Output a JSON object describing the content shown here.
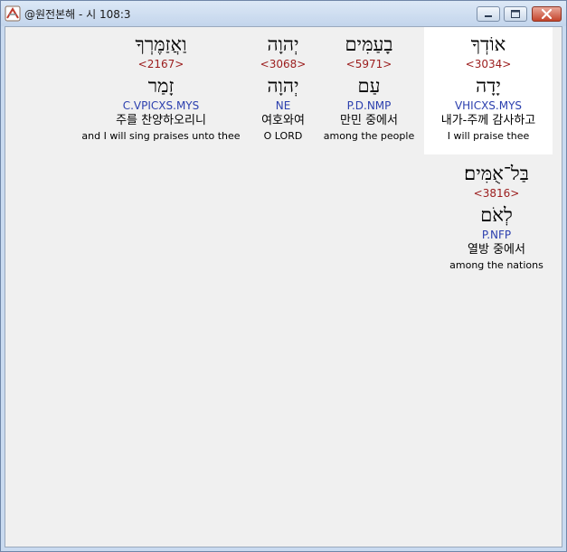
{
  "window": {
    "title": "@원전본해 - 시 108:3"
  },
  "words": [
    {
      "hebrew": "אוֹדְךָ",
      "strong": "<3034>",
      "lemma": "יָדָה",
      "morph": "VHICXS.MYS",
      "korean": "내가-주께 감사하고",
      "english": "I will praise thee",
      "selected": true
    },
    {
      "hebrew": "בָעַמִּים",
      "strong": "<5971>",
      "lemma": "עַם",
      "morph": "P.D.NMP",
      "korean": "만민 중에서",
      "english": "among the people",
      "selected": false
    },
    {
      "hebrew": "יְהוָה",
      "strong": "<3068>",
      "lemma": "יְהוָה",
      "morph": "NE",
      "korean": "여호와여",
      "english": "O LORD",
      "selected": false
    },
    {
      "hebrew": "וַאֲזַמֶּרְךָ",
      "strong": "<2167>",
      "lemma": "זָמַר",
      "morph": "C.VPICXS.MYS",
      "korean": "주를 찬양하오리니",
      "english": "and I will sing praises unto thee",
      "selected": false
    },
    {
      "hebrew": "בַּל־אֻמִּים׃",
      "strong": "<3816>",
      "lemma": "לְאֹם",
      "morph": "P.NFP",
      "korean": "열방 중에서",
      "english": "among the nations",
      "selected": false
    }
  ]
}
